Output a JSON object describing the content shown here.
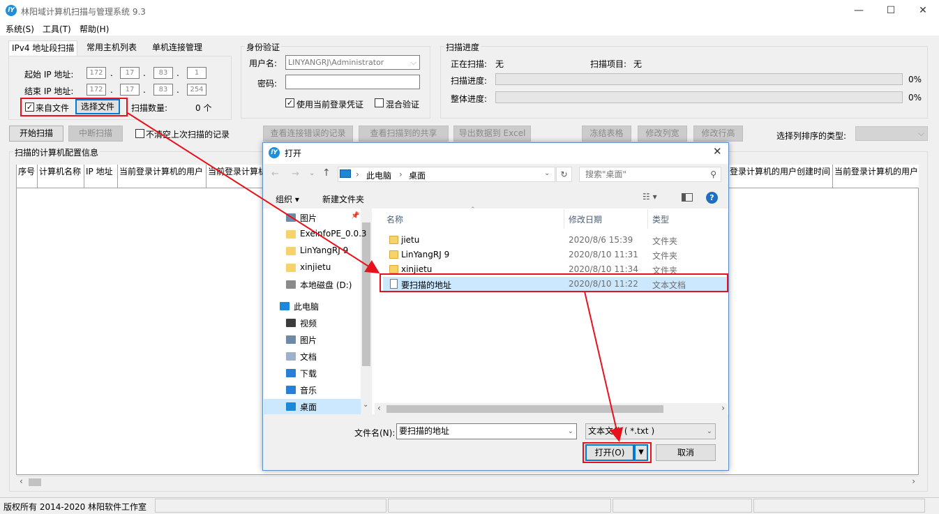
{
  "app": {
    "title": "林阳域计算机扫描与管理系统 9.3",
    "logo_text": "lY",
    "window_controls": {
      "minimize": "—",
      "maximize": "☐",
      "close": "✕"
    }
  },
  "menu": [
    "系统(S)",
    "工具(T)",
    "帮助(H)"
  ],
  "tabs": [
    "IPv4 地址段扫描",
    "常用主机列表",
    "单机连接管理"
  ],
  "ip_scan": {
    "start_label": "起始 IP 地址:",
    "end_label": "结束 IP 地址:",
    "start_ip": [
      "172",
      "17",
      "83",
      "1"
    ],
    "end_ip": [
      "172",
      "17",
      "83",
      "254"
    ],
    "dot": ".",
    "from_file_label": "来自文件",
    "from_file_checked": "✓",
    "choose_file_btn": "选择文件",
    "scan_count_label": "扫描数量:",
    "scan_count_value": "0 个"
  },
  "auth": {
    "title": "身份验证",
    "username_label": "用户名:",
    "username_value": "LINYANGRJ\\Administrator",
    "password_label": "密码:",
    "use_current_label": "使用当前登录凭证",
    "use_current_checked": "✓",
    "mixed_label": "混合验证"
  },
  "progress": {
    "title": "扫描进度",
    "scanning_label": "正在扫描:",
    "scanning_value": "无",
    "item_label": "扫描项目:",
    "item_value": "无",
    "scan_progress_label": "扫描进度:",
    "scan_progress_value": "0%",
    "scan_progress_fraction": 0,
    "total_progress_label": "整体进度:",
    "total_progress_value": "0%",
    "total_progress_fraction": 0
  },
  "toolbar": {
    "start_scan": "开始扫描",
    "stop_scan": "中断扫描",
    "keep_last_label": "不清空上次扫描的记录",
    "view_errors": "查看连接错误的记录",
    "view_shares": "查看扫描到的共享",
    "export_excel": "导出数据到 Excel",
    "freeze": "冻结表格",
    "col_width": "修改列宽",
    "row_height": "修改行高",
    "sort_label": "选择列排序的类型:"
  },
  "table": {
    "group_title": "扫描的计算机配置信息",
    "headers_left": [
      "序号",
      "计算机名称",
      "IP 地址",
      "当前登录计算机的用户",
      "当前登录计算机"
    ],
    "headers_right": [
      "登录计算机的用户创建时间",
      "当前登录计算机的用户"
    ]
  },
  "status": {
    "copyright": "版权所有 2014-2020 林阳软件工作室"
  },
  "dialog": {
    "title": "打开",
    "breadcrumb": [
      "此电脑",
      "桌面"
    ],
    "search_placeholder": "搜索\"桌面\"",
    "organize": "组织 ▾",
    "new_folder": "新建文件夹",
    "nav_items": [
      {
        "label": "图片",
        "icon": "pictures-icon"
      },
      {
        "label": "ExeinfoPE_0.0.3",
        "icon": "folder-icon"
      },
      {
        "label": "LinYangRJ 9",
        "icon": "folder-icon"
      },
      {
        "label": "xinjietu",
        "icon": "folder-icon"
      },
      {
        "label": "本地磁盘 (D:)",
        "icon": "drive-icon"
      },
      {
        "label": "此电脑",
        "icon": "computer-icon"
      },
      {
        "label": "视频",
        "icon": "video-icon"
      },
      {
        "label": "图片",
        "icon": "pictures-icon"
      },
      {
        "label": "文档",
        "icon": "documents-icon"
      },
      {
        "label": "下载",
        "icon": "download-icon"
      },
      {
        "label": "音乐",
        "icon": "music-icon"
      },
      {
        "label": "桌面",
        "icon": "desktop-icon"
      }
    ],
    "columns": {
      "name": "名称",
      "date": "修改日期",
      "type": "类型"
    },
    "files": [
      {
        "name": "jietu",
        "date": "2020/8/6 15:39",
        "type": "文件夹",
        "kind": "folder"
      },
      {
        "name": "LinYangRJ 9",
        "date": "2020/8/10 11:31",
        "type": "文件夹",
        "kind": "folder"
      },
      {
        "name": "xinjietu",
        "date": "2020/8/10 11:34",
        "type": "文件夹",
        "kind": "folder"
      },
      {
        "name": "要扫描的地址",
        "date": "2020/8/10 11:22",
        "type": "文本文档",
        "kind": "text"
      }
    ],
    "filename_label": "文件名(N):",
    "filename_value": "要扫描的地址",
    "filetype_value": "文本文件 ( *.txt )",
    "open_btn": "打开(O)",
    "cancel_btn": "取消"
  },
  "colors": {
    "highlight_red": "#e8101a",
    "accent_blue": "#0078d7",
    "selected_row": "#cce8ff"
  }
}
